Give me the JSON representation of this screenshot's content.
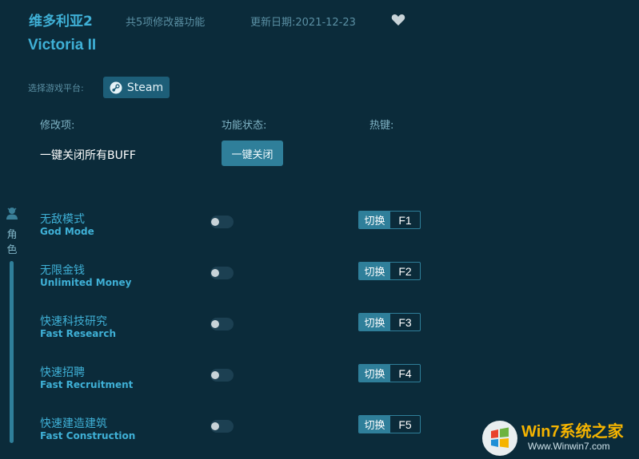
{
  "header": {
    "title_cn": "维多利亚2",
    "feature_count": "共5项修改器功能",
    "update_date": "更新日期:2021-12-23",
    "title_en": "Victoria II"
  },
  "platform": {
    "label": "选择游戏平台:",
    "steam_label": "Steam"
  },
  "columns": {
    "name": "修改项:",
    "state": "功能状态:",
    "hotkey": "热键:"
  },
  "all_buff": {
    "label": "一键关闭所有BUFF",
    "button": "一键关闭"
  },
  "sidebar": {
    "category_label": "角色"
  },
  "cheats": [
    {
      "name_cn": "无敌模式",
      "name_en": "God Mode",
      "enabled": false,
      "action": "切换",
      "key": "F1"
    },
    {
      "name_cn": "无限金钱",
      "name_en": "Unlimited Money",
      "enabled": false,
      "action": "切换",
      "key": "F2"
    },
    {
      "name_cn": "快速科技研究",
      "name_en": "Fast Research",
      "enabled": false,
      "action": "切换",
      "key": "F3"
    },
    {
      "name_cn": "快速招聘",
      "name_en": "Fast Recruitment",
      "enabled": false,
      "action": "切换",
      "key": "F4"
    },
    {
      "name_cn": "快速建造建筑",
      "name_en": "Fast Construction",
      "enabled": false,
      "action": "切换",
      "key": "F5"
    }
  ],
  "watermark": {
    "brand": "Win7系统之家",
    "url": "Www.Winwin7.com"
  },
  "colors": {
    "background": "#0b2b3a",
    "accent": "#3fb0d6",
    "button": "#2f7f9a"
  }
}
